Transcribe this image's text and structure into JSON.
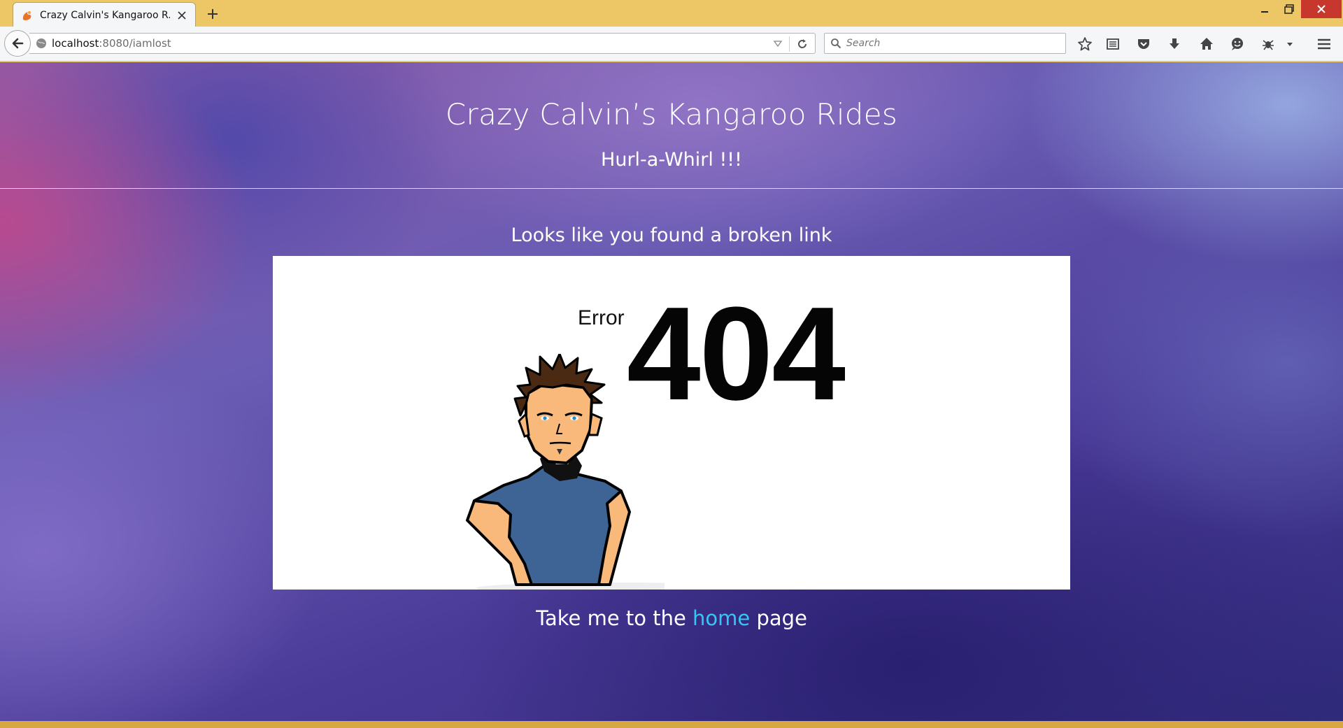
{
  "browser": {
    "tab_title": "Crazy Calvin's Kangaroo R...",
    "url_host": "localhost",
    "url_rest": ":8080/iamlost",
    "search_placeholder": "Search",
    "icons": [
      "firefox-icon",
      "close-tab-icon",
      "new-tab-icon",
      "minimize-icon",
      "maximize-icon",
      "window-close-icon",
      "back-arrow-icon",
      "globe-icon",
      "dropdown-icon",
      "reload-icon",
      "search-icon",
      "bookmark-star-icon",
      "reading-list-icon",
      "pocket-icon",
      "download-icon",
      "home-icon",
      "smiley-icon",
      "extension-icon",
      "overflow-dropdown-icon",
      "hamburger-menu-icon"
    ]
  },
  "page": {
    "title": "Crazy Calvin’s Kangaroo Rides",
    "subtitle": "Hurl-a-Whirl !!!",
    "broken_message": "Looks like you found a broken link",
    "error_label": "Error",
    "error_code": "404",
    "home_prefix": "Take me to the ",
    "home_link": "home",
    "home_suffix": " page"
  },
  "colors": {
    "link": "#36c6f3",
    "titlebar": "#edc665",
    "close_button": "#c7372e"
  }
}
